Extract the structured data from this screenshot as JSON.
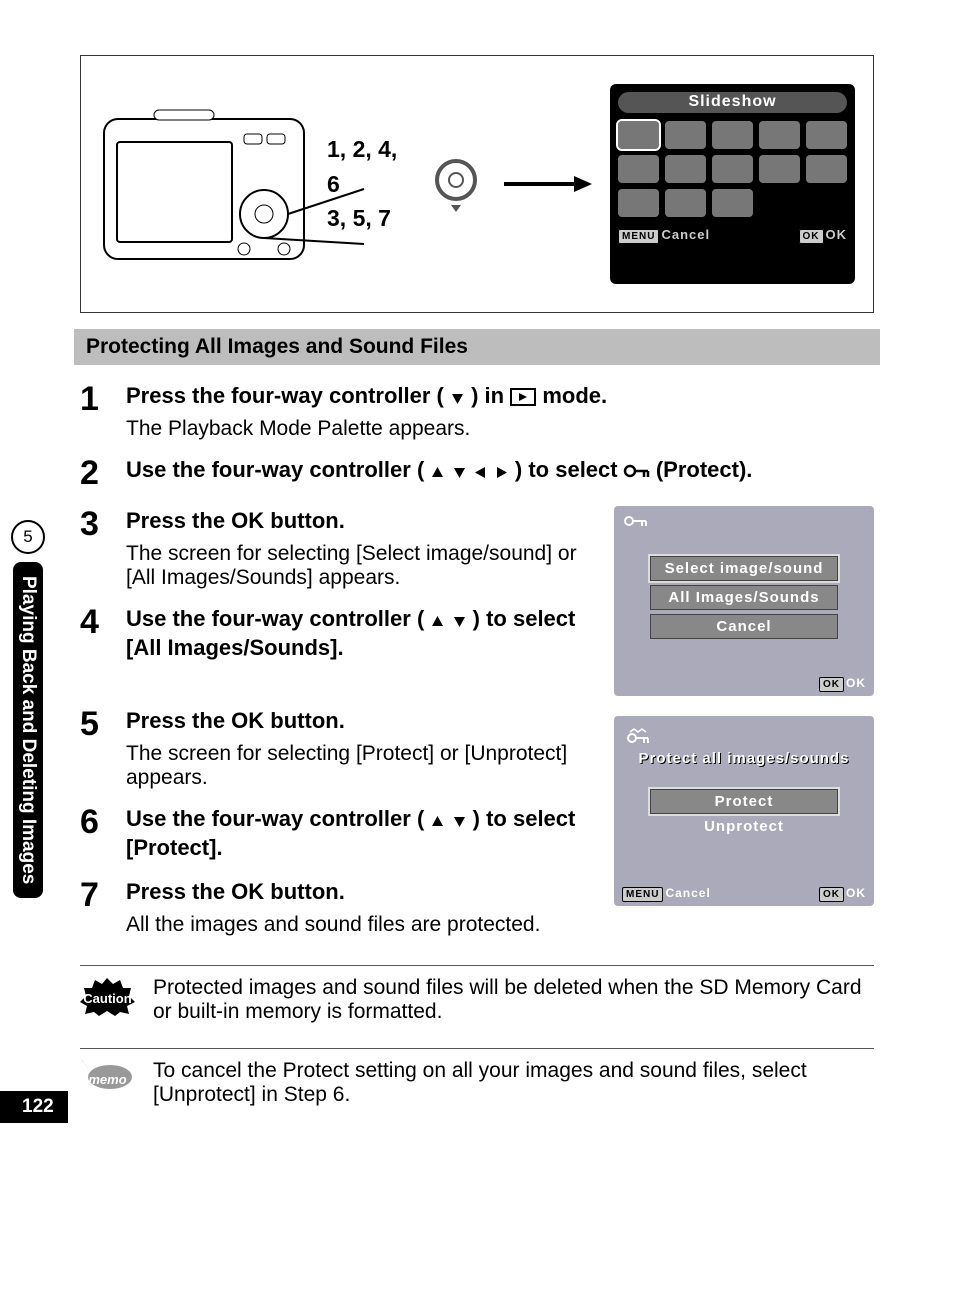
{
  "side_tab": {
    "chapter": "5",
    "label": "Playing Back and Deleting Images"
  },
  "page_number": "122",
  "topbox": {
    "step_lines": [
      "1, 2, 4, 6",
      "3, 5, 7"
    ],
    "lcd": {
      "title": "Slideshow",
      "menu": "MENU",
      "cancel": "Cancel",
      "okb": "OK",
      "ok": "OK"
    }
  },
  "section_title": "Protecting All Images and Sound Files",
  "steps": [
    {
      "n": "1",
      "title_a": "Press the four-way controller (",
      "title_b": ") in ",
      "title_c": " mode.",
      "body": "The Playback Mode Palette appears."
    },
    {
      "n": "2",
      "title_a": "Use the four-way controller (",
      "title_b": ") to select ",
      "title_c": " (Protect)."
    },
    {
      "n": "3",
      "title_a": "Press the ",
      "ok": "OK",
      "title_b": " button.",
      "body": "The screen for selecting [Select image/sound] or [All Images/Sounds] appears."
    },
    {
      "n": "4",
      "title_a": "Use the four-way controller (",
      "title_b": ") to select [All Images/Sounds]."
    },
    {
      "n": "5",
      "title_a": "Press the ",
      "ok": "OK",
      "title_b": " button.",
      "body": "The screen for selecting [Protect] or [Unprotect] appears."
    },
    {
      "n": "6",
      "title_a": "Use the four-way controller (",
      "title_b": ") to select [Protect]."
    },
    {
      "n": "7",
      "title_a": "Press the ",
      "ok": "OK",
      "title_b": " button.",
      "body": "All the images and sound files are protected."
    }
  ],
  "mini1": {
    "opt1": "Select image/sound",
    "opt2": "All Images/Sounds",
    "opt3": "Cancel",
    "okb": "OK",
    "ok": "OK"
  },
  "mini2": {
    "head": "Protect all images/sounds",
    "opt1": "Protect",
    "opt2": "Unprotect",
    "menu": "MENU",
    "cancel": "Cancel",
    "okb": "OK",
    "ok": "OK"
  },
  "caution": {
    "label": "Caution",
    "text": "Protected images and sound files will be deleted when the SD Memory Card or built-in memory is formatted."
  },
  "memo": {
    "label": "memo",
    "text": "To cancel the Protect setting on all your images and sound files, select [Unprotect] in Step 6."
  }
}
